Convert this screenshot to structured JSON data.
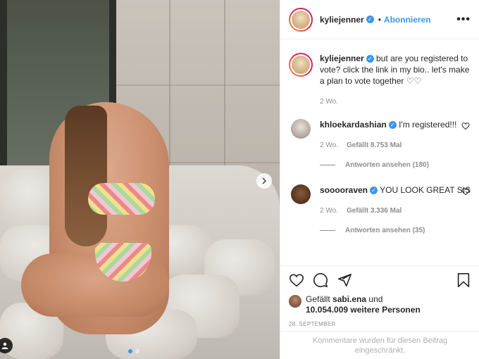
{
  "post": {
    "username": "kyliejenner",
    "verified": true,
    "separator": "•",
    "follow_label": "Abonnieren",
    "more_icon": "more-horizontal-icon"
  },
  "photo": {
    "carousel_total": 2,
    "carousel_active": 1,
    "next_icon": "chevron-right-icon",
    "tag_icon": "user-tag-icon"
  },
  "caption": {
    "username": "kyliejenner",
    "text": "but are you registered to vote? click the link in my bio.. let's make a plan to vote together ♡♡",
    "time": "2 Wo."
  },
  "comments": [
    {
      "username": "khloekardashian",
      "verified": true,
      "text": "I'm registered!!!",
      "time": "2 Wo.",
      "likes": "Gefällt 8.753 Mal",
      "replies": "Antworten ansehen (180)"
    },
    {
      "username": "sooooraven",
      "verified": true,
      "text": "YOU LOOK GREAT SIS",
      "time": "2 Wo.",
      "likes": "Gefällt 3.336 Mal",
      "replies": "Antworten ansehen (35)"
    }
  ],
  "likes": {
    "prefix": "Gefällt",
    "user": "sabi.ena",
    "connector": "und",
    "count_text": "10.054.009 weitere Personen"
  },
  "date": "28. SEPTEMBER",
  "restricted_text": "Kommentare wurden für diesen Beitrag eingeschränkt.",
  "colors": {
    "accent": "#3897f0",
    "text": "#262626",
    "muted": "#8e8e8e"
  }
}
